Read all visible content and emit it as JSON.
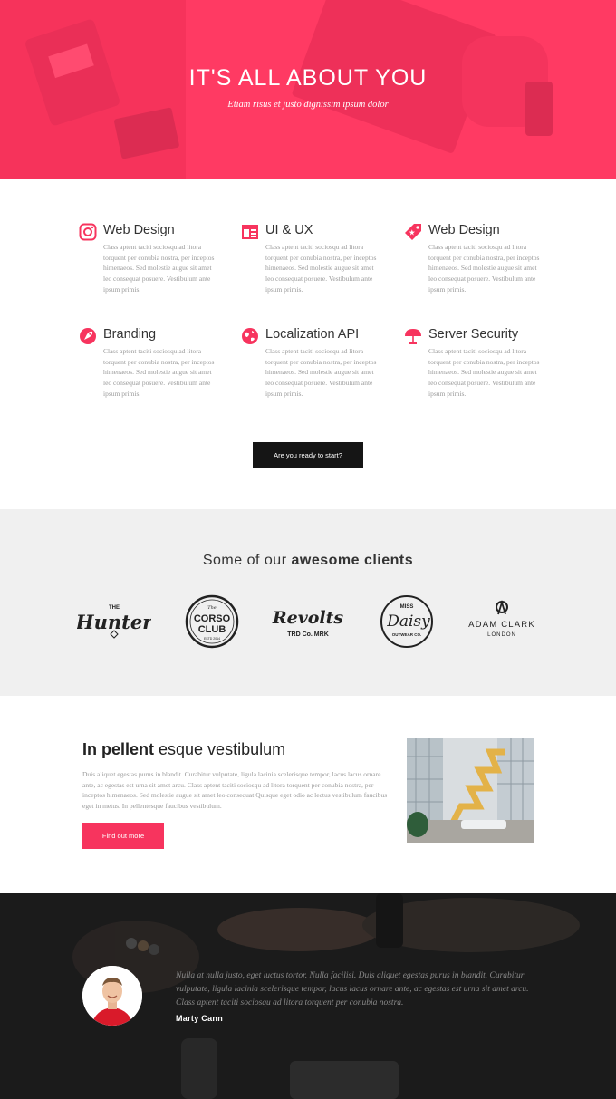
{
  "hero": {
    "title": "IT'S ALL ABOUT YOU",
    "subtitle": "Etiam risus et justo dignissim ipsum dolor"
  },
  "features": [
    {
      "icon": "instagram-icon",
      "title": "Web Design",
      "desc": "Class aptent taciti sociosqu ad litora torquent per conubia nostra, per inceptos himenaeos. Sed molestie augue sit amet leo consequat posuere. Vestibulum ante ipsum primis."
    },
    {
      "icon": "layout-icon",
      "title": "UI & UX",
      "desc": "Class aptent taciti sociosqu ad litora torquent per conubia nostra, per inceptos himenaeos. Sed molestie augue sit amet leo consequat posuere. Vestibulum ante ipsum primis."
    },
    {
      "icon": "tag-icon",
      "title": "Web Design",
      "desc": "Class aptent taciti sociosqu ad litora torquent per conubia nostra, per inceptos himenaeos. Sed molestie augue sit amet leo consequat posuere. Vestibulum ante ipsum primis."
    },
    {
      "icon": "rocket-icon",
      "title": "Branding",
      "desc": "Class aptent taciti sociosqu ad litora torquent per conubia nostra, per inceptos himenaeos. Sed molestie augue sit amet leo consequat posuere. Vestibulum ante ipsum primis."
    },
    {
      "icon": "globe-icon",
      "title": "Localization API",
      "desc": "Class aptent taciti sociosqu ad litora torquent per conubia nostra, per inceptos himenaeos. Sed molestie augue sit amet leo consequat posuere. Vestibulum ante ipsum primis."
    },
    {
      "icon": "umbrella-icon",
      "title": "Server Security",
      "desc": "Class aptent taciti sociosqu ad litora torquent per conubia nostra, per inceptos himenaeos. Sed molestie augue sit amet leo consequat posuere. Vestibulum ante ipsum primis."
    }
  ],
  "cta": {
    "label": "Are you ready to start?"
  },
  "clients": {
    "title_light": "Some of our ",
    "title_bold": "awesome clients",
    "logos": [
      {
        "small": "THE",
        "main": "Hunter"
      },
      {
        "small": "The",
        "main": "CORSO CLUB",
        "sub": "ESTD 2014"
      },
      {
        "main": "Revolts",
        "sub": "TRD Co. MRK"
      },
      {
        "small": "MISS",
        "main": "Daisy",
        "sub": "OUTWEAR CO."
      },
      {
        "main": "ADAM CLARK",
        "sub": "LONDON"
      }
    ]
  },
  "about": {
    "title_bold": "In pellent",
    "title_light": " esque vestibulum",
    "text": "Duis aliquet egestas purus in blandit. Curabitur vulputate, ligula lacinia scelerisque tempor, lacus lacus ornare ante, ac egestas est urna sit amet arcu. Class aptent taciti sociosqu ad litora torquent per conubia nostra, per inceptos himenaeos. Sed molestie augue sit amet leo consequat Quisque eget odio ac lectus vestibulum faucibus eget in metus. In pellentesque faucibus vestibulum.",
    "button": "Find out more"
  },
  "testimonial": {
    "quote": "Nulla at nulla justo, eget luctus tortor. Nulla facilisi. Duis aliquet egestas purus in blandit. Curabitur vulputate, ligula lacinia scelerisque tempor, lacus lacus ornare ante, ac egestas est urna sit amet arcu. Class aptent taciti sociosqu ad litora torquent per conubia nostra.",
    "author": "Marty Cann"
  },
  "colors": {
    "accent": "#ff3a63",
    "dark": "#151515",
    "grey_bg": "#f0f0f0"
  }
}
